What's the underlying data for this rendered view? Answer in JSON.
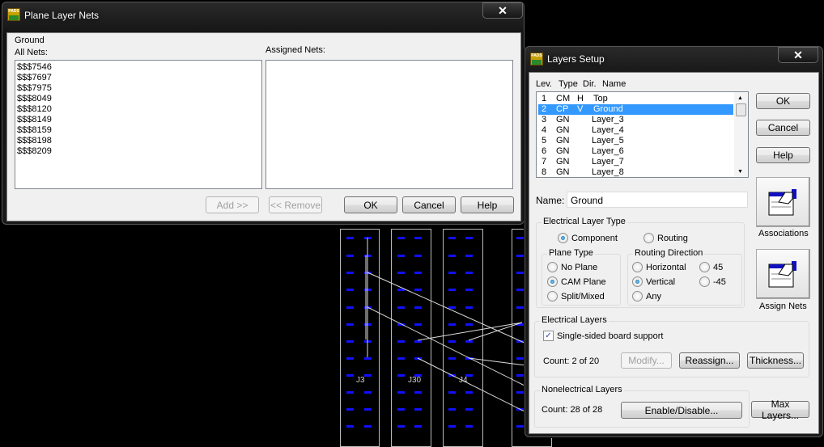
{
  "plane_dialog": {
    "title": "Plane Layer Nets",
    "close": "✕",
    "layer_name": "Ground",
    "all_nets_label": "All Nets:",
    "assigned_label": "Assigned Nets:",
    "all_nets": [
      "$$$7546",
      "$$$7697",
      "$$$7975",
      "$$$8049",
      "$$$8120",
      "$$$8149",
      "$$$8159",
      "$$$8198",
      "$$$8209"
    ],
    "add": "Add >>",
    "remove": "<< Remove",
    "ok": "OK",
    "cancel": "Cancel",
    "help": "Help"
  },
  "layers_dialog": {
    "title": "Layers Setup",
    "close": "✕",
    "header": {
      "lev": "Lev.",
      "type": "Type",
      "dir": "Dir.",
      "name": "Name"
    },
    "layers": [
      {
        "lev": "1",
        "type": "CM",
        "dir": "H",
        "name": "Top"
      },
      {
        "lev": "2",
        "type": "CP",
        "dir": "V",
        "name": "Ground"
      },
      {
        "lev": "3",
        "type": "GN",
        "dir": "",
        "name": "Layer_3"
      },
      {
        "lev": "4",
        "type": "GN",
        "dir": "",
        "name": "Layer_4"
      },
      {
        "lev": "5",
        "type": "GN",
        "dir": "",
        "name": "Layer_5"
      },
      {
        "lev": "6",
        "type": "GN",
        "dir": "",
        "name": "Layer_6"
      },
      {
        "lev": "7",
        "type": "GN",
        "dir": "",
        "name": "Layer_7"
      },
      {
        "lev": "8",
        "type": "GN",
        "dir": "",
        "name": "Layer_8"
      }
    ],
    "selected_index": 1,
    "ok": "OK",
    "cancel": "Cancel",
    "help": "Help",
    "name_label": "Name:",
    "name_value": "Ground",
    "associations": "Associations",
    "assign_nets": "Assign Nets",
    "elec_type": {
      "title": "Electrical Layer Type",
      "component": "Component",
      "routing": "Routing"
    },
    "plane_type": {
      "title": "Plane Type",
      "no_plane": "No Plane",
      "cam_plane": "CAM Plane",
      "split": "Split/Mixed"
    },
    "routing_dir": {
      "title": "Routing Direction",
      "horizontal": "Horizontal",
      "vertical": "Vertical",
      "any": "Any",
      "p45": "45",
      "m45": "-45"
    },
    "electrical": {
      "title": "Electrical Layers",
      "single_sided": "Single-sided board support",
      "count": "Count:  2 of 20",
      "modify": "Modify...",
      "reassign": "Reassign...",
      "thickness": "Thickness..."
    },
    "nonelectrical": {
      "title": "Nonelectrical Layers",
      "count": "Count: 28 of 28",
      "enable": "Enable/Disable...",
      "max_layers": "Max Layers..."
    }
  },
  "pcb": {
    "refs": [
      "J3",
      "J30",
      "J4"
    ]
  }
}
